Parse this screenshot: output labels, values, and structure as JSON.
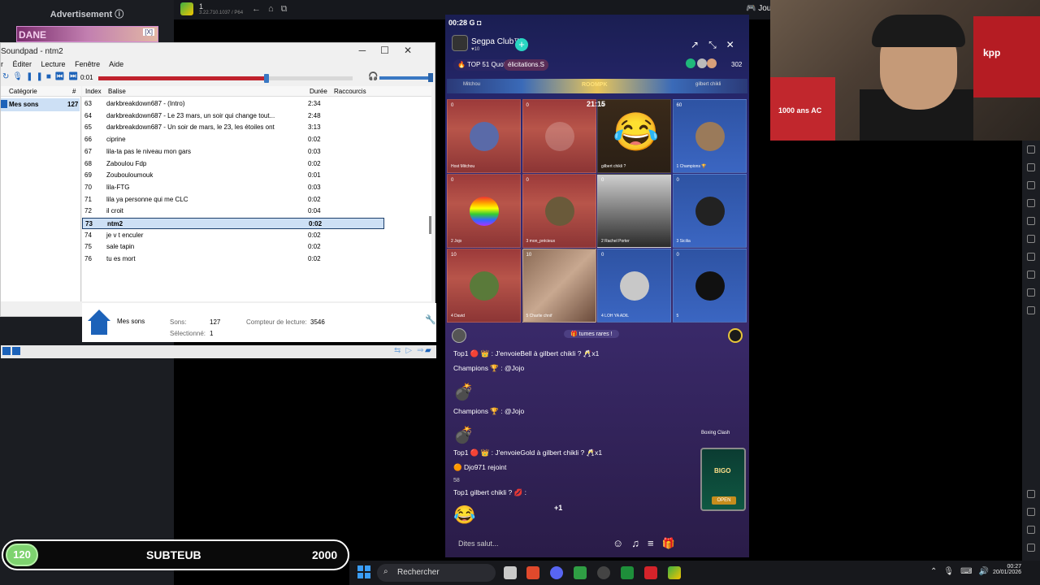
{
  "sidebar": {
    "advertisement_label": "Advertisement ⓘ",
    "ad_text": "DANE",
    "ad_badge": "[X]"
  },
  "desktop_bar": {
    "tab_number": "1",
    "tab_sub": "3.22.710.1037 / P64",
    "right_label": "Jou"
  },
  "soundpad": {
    "title": "Soundpad - ntm2",
    "menu": [
      "r",
      "Éditer",
      "Lecture",
      "Fenêtre",
      "Aide"
    ],
    "time": "0:01",
    "progress": 0.66,
    "volume": 1.0,
    "category_header": "Catégorie",
    "category_hash": "#",
    "category": {
      "name": "Mes sons",
      "count": "127"
    },
    "columns": {
      "index": "Index",
      "tag": "Balise",
      "duration": "Durée",
      "shortcuts": "Raccourcis"
    },
    "rows": [
      {
        "index": "63",
        "tag": "darkbreakdown687 - (Intro)",
        "duration": "2:34"
      },
      {
        "index": "64",
        "tag": "darkbreakdown687 - Le 23 mars, un soir qui change tout...",
        "duration": "2:48"
      },
      {
        "index": "65",
        "tag": "darkbreakdown687 - Un soir de mars, le 23, les étoiles ont",
        "duration": "3:13"
      },
      {
        "index": "66",
        "tag": "ciprine",
        "duration": "0:02"
      },
      {
        "index": "67",
        "tag": "lila-ta pas le niveau mon gars",
        "duration": "0:03"
      },
      {
        "index": "68",
        "tag": "Zaboulou Fdp",
        "duration": "0:02"
      },
      {
        "index": "69",
        "tag": "Zouboulou­mouk",
        "duration": "0:01"
      },
      {
        "index": "70",
        "tag": "lila-FTG",
        "duration": "0:03"
      },
      {
        "index": "71",
        "tag": "lila ya personne qui me CLC",
        "duration": "0:02"
      },
      {
        "index": "72",
        "tag": "il croit",
        "duration": "0:04"
      },
      {
        "index": "73",
        "tag": "ntm2",
        "duration": "0:02",
        "selected": true
      },
      {
        "index": "74",
        "tag": "je v t enculer",
        "duration": "0:02"
      },
      {
        "index": "75",
        "tag": "sale tapin",
        "duration": "0:02"
      },
      {
        "index": "76",
        "tag": "tu es mort",
        "duration": "0:02"
      }
    ],
    "footer": {
      "category_name": "Mes sons",
      "sons_label": "Sons:",
      "sons_value": "127",
      "selected_label": "Sélectionné:",
      "selected_value": "1",
      "counter_label": "Compteur de lecture:",
      "counter_value": "3546"
    }
  },
  "phone": {
    "status_time": "00:28",
    "status_icons": "G ◘",
    "club_name": "Segpa Club™",
    "club_sub": "♥10",
    "top_badge": "🔥 TOP 51 Quot",
    "elic_badge": "élicitations.S",
    "viewer_count": "302",
    "pk_left": "Mitchou",
    "pk_mid": "ROOMPK",
    "pk_right": "gilbert chikli",
    "timer": "21:15",
    "seats": [
      {
        "num": "0",
        "name": "Host  Mitchou"
      },
      {
        "num": "0",
        "name": ""
      },
      {
        "num": "0",
        "name": "gilbert chikli ?"
      },
      {
        "num": "60",
        "name": "1  Champions 🏆"
      },
      {
        "num": "0",
        "name": "2  Jojo"
      },
      {
        "num": "0",
        "name": "3  mon_précieux"
      },
      {
        "num": "0",
        "name": "2  Rachel Porter"
      },
      {
        "num": "0",
        "name": "3  Sicilia"
      },
      {
        "num": "10",
        "name": "4  David"
      },
      {
        "num": "10",
        "name": "5  Charlie chnif"
      },
      {
        "num": "0",
        "name": "4  LOH YA ADIL"
      },
      {
        "num": "0",
        "name": "5"
      }
    ],
    "rare_banner": "🎁 tumes rares !",
    "chat": [
      {
        "text": "Top1  🔴 👑 : J'envoieBell à gilbert chikli ? 🥂x1"
      },
      {
        "text": "Champions 🏆 : @Jojo"
      },
      {
        "text": "💣"
      },
      {
        "text": "Champions 🏆 : @Jojo"
      },
      {
        "text": "💣"
      },
      {
        "text": "Top1  🔴 👑 : J'envoieGold à gilbert chikli ? 🥂x1"
      },
      {
        "text": "🟠 Djo971 rejoint"
      },
      {
        "text": "Top1  gilbert chikli ? 💋 :"
      },
      {
        "text": "😂"
      }
    ],
    "chat_sub": "58",
    "plus_one": "+1",
    "boxing": "Boxing Clash",
    "card_open": "OPEN",
    "card_title": "BIGO",
    "input_placeholder": "Dites salut..."
  },
  "webcam": {
    "shirt_text": "1000 ans AC",
    "poster_text": "kpp"
  },
  "overlay": {
    "badge_value": "120",
    "label": "SUBTEUB",
    "value": "2000"
  },
  "taskbar": {
    "search_label": "Rechercher",
    "time": "00:27",
    "date": "20/01/2026"
  }
}
